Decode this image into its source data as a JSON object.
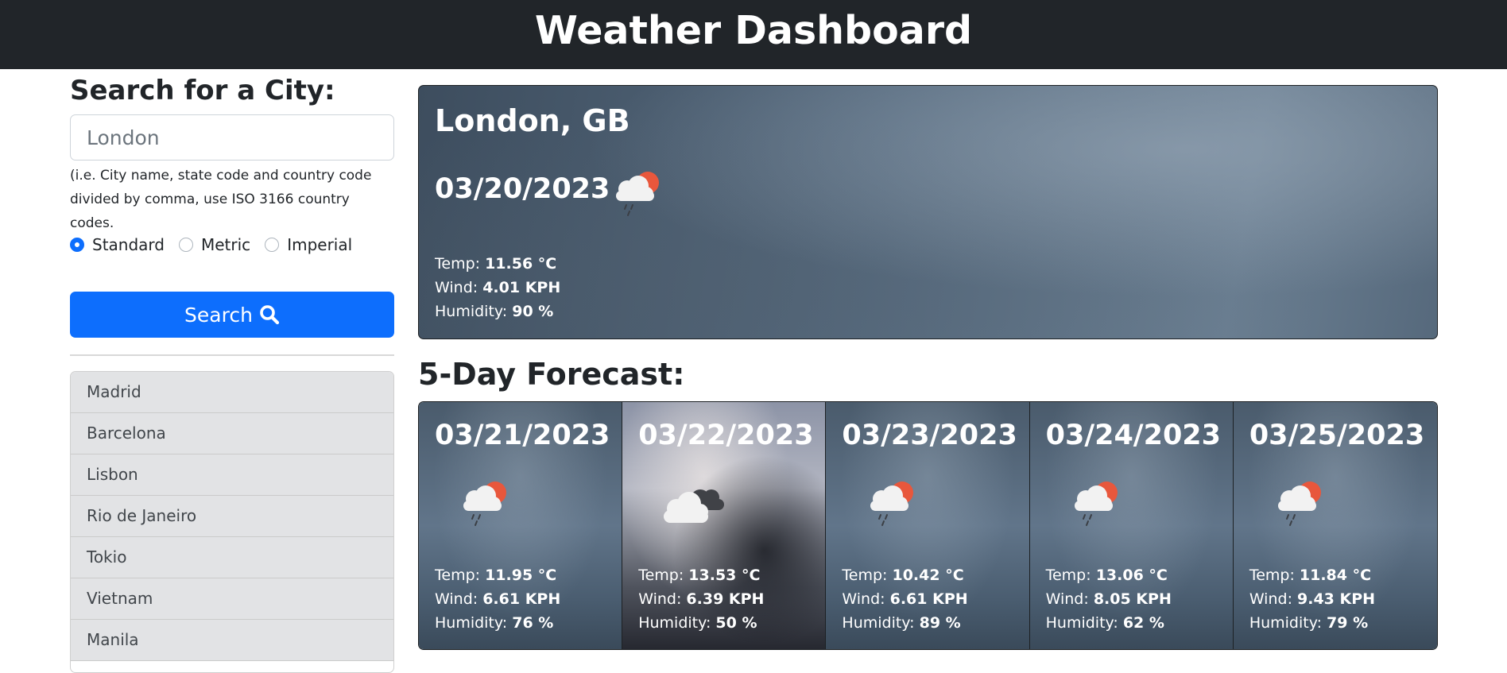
{
  "header": {
    "title": "Weather Dashboard"
  },
  "search": {
    "title": "Search for a City:",
    "placeholder": "London",
    "help_text": "(i.e. City name, state code and country code divided by comma, use ISO 3166 country codes.",
    "units": [
      {
        "label": "Standard",
        "checked": true
      },
      {
        "label": "Metric",
        "checked": false
      },
      {
        "label": "Imperial",
        "checked": false
      }
    ],
    "button_label": "Search"
  },
  "history": [
    "Madrid",
    "Barcelona",
    "Lisbon",
    "Rio de Janeiro",
    "Tokio",
    "Vietnam",
    "Manila"
  ],
  "current": {
    "city": "London,  GB",
    "date": "03/20/2023",
    "icon": "cloud-rain-sun-icon",
    "temp_label": "Temp: ",
    "temp": "11.56 °C",
    "wind_label": "Wind: ",
    "wind": "4.01 KPH",
    "humidity_label": "Humidity: ",
    "humidity": "90 %"
  },
  "forecast": {
    "title": "5-Day Forecast:",
    "days": [
      {
        "date": "03/21/2023",
        "icon": "cloud-rain-sun-icon",
        "temp": "11.95 °C",
        "wind": "6.61 KPH",
        "humidity": "76 %"
      },
      {
        "date": "03/22/2023",
        "icon": "clouds-icon",
        "temp": "13.53 °C",
        "wind": "6.39 KPH",
        "humidity": "50 %"
      },
      {
        "date": "03/23/2023",
        "icon": "cloud-rain-sun-icon",
        "temp": "10.42 °C",
        "wind": "6.61 KPH",
        "humidity": "89 %"
      },
      {
        "date": "03/24/2023",
        "icon": "cloud-rain-sun-icon",
        "temp": "13.06 °C",
        "wind": "8.05 KPH",
        "humidity": "62 %"
      },
      {
        "date": "03/25/2023",
        "icon": "cloud-rain-sun-icon",
        "temp": "11.84 °C",
        "wind": "9.43 KPH",
        "humidity": "79 %"
      }
    ]
  },
  "colors": {
    "header_bg": "#212529",
    "button_bg": "#0d6efd",
    "history_bg": "#e2e3e5",
    "sun": "#e8573c"
  }
}
